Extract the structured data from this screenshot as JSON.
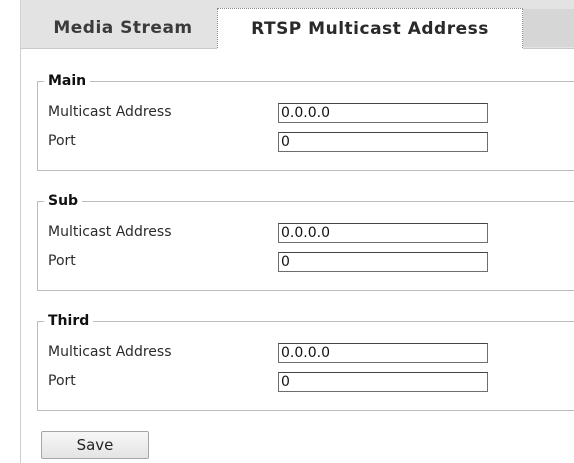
{
  "tabs": [
    {
      "label": "Media Stream",
      "active": false
    },
    {
      "label": "RTSP Multicast Address",
      "active": true
    }
  ],
  "groups": {
    "main": {
      "legend": "Main",
      "multicast_label": "Multicast Address",
      "multicast_value": "0.0.0.0",
      "port_label": "Port",
      "port_value": "0"
    },
    "sub": {
      "legend": "Sub",
      "multicast_label": "Multicast Address",
      "multicast_value": "0.0.0.0",
      "port_label": "Port",
      "port_value": "0"
    },
    "third": {
      "legend": "Third",
      "multicast_label": "Multicast Address",
      "multicast_value": "0.0.0.0",
      "port_label": "Port",
      "port_value": "0"
    }
  },
  "actions": {
    "save_label": "Save"
  }
}
